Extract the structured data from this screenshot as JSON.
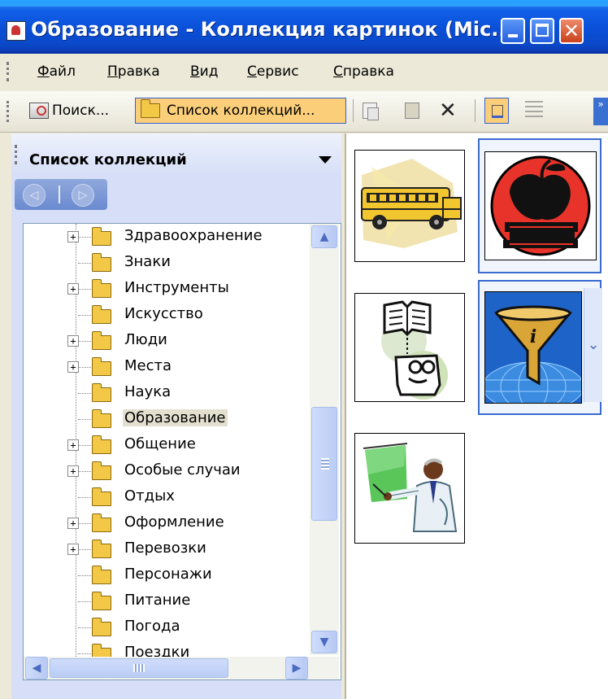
{
  "window": {
    "title": "Образование - Коллекция картинок (Mic...",
    "controls": {
      "minimize": "minimize",
      "maximize": "maximize",
      "close": "✕"
    }
  },
  "menu": [
    {
      "label": "Файл"
    },
    {
      "label": "Правка"
    },
    {
      "label": "Вид"
    },
    {
      "label": "Сервис"
    },
    {
      "label": "Справка"
    }
  ],
  "toolbar": {
    "search_label": "Поиск...",
    "collections_label": "Список коллекций...",
    "delete_glyph": "✕",
    "overflow_glyph": "»"
  },
  "pane": {
    "title": "Список коллекций",
    "back_glyph": "◁",
    "forward_glyph": "▷"
  },
  "tree": {
    "items": [
      {
        "label": "Здравоохранение",
        "expandable": true,
        "selected": false
      },
      {
        "label": "Знаки",
        "expandable": false,
        "selected": false
      },
      {
        "label": "Инструменты",
        "expandable": true,
        "selected": false
      },
      {
        "label": "Искусство",
        "expandable": false,
        "selected": false
      },
      {
        "label": "Люди",
        "expandable": true,
        "selected": false
      },
      {
        "label": "Места",
        "expandable": true,
        "selected": false
      },
      {
        "label": "Наука",
        "expandable": false,
        "selected": false
      },
      {
        "label": "Образование",
        "expandable": false,
        "selected": true
      },
      {
        "label": "Общение",
        "expandable": true,
        "selected": false
      },
      {
        "label": "Особые случаи",
        "expandable": true,
        "selected": false
      },
      {
        "label": "Отдых",
        "expandable": false,
        "selected": false
      },
      {
        "label": "Оформление",
        "expandable": true,
        "selected": false
      },
      {
        "label": "Перевозки",
        "expandable": true,
        "selected": false
      },
      {
        "label": "Персонажи",
        "expandable": false,
        "selected": false
      },
      {
        "label": "Питание",
        "expandable": false,
        "selected": false
      },
      {
        "label": "Погода",
        "expandable": false,
        "selected": false
      },
      {
        "label": "Поездки",
        "expandable": false,
        "selected": false
      }
    ],
    "expand_glyph": "+"
  },
  "gallery": [
    {
      "name": "school-bus-clipart",
      "selected": false
    },
    {
      "name": "apple-books-clipart",
      "selected": true
    },
    {
      "name": "reader-book-clipart",
      "selected": false
    },
    {
      "name": "info-funnel-clipart",
      "selected": true
    },
    {
      "name": "teacher-board-clipart",
      "selected": false
    }
  ],
  "colors": {
    "title_bar": "#0a4fd8",
    "selection": "#3a6bd0",
    "folder": "#f2c846",
    "active_button": "#fbcf7a"
  }
}
